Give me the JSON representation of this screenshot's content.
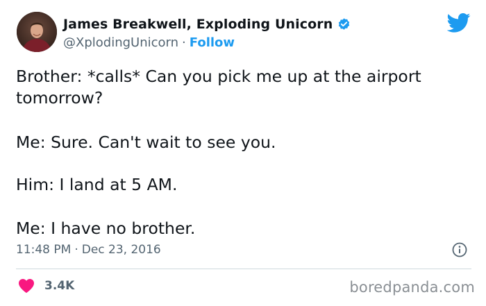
{
  "author": {
    "display_name": "James Breakwell, Exploding Unicorn",
    "handle": "@XplodingUnicorn",
    "separator": "·",
    "follow_label": "Follow",
    "verified": true
  },
  "icons": {
    "verified": "verified-badge-icon",
    "platform": "twitter-bird-icon",
    "info": "info-icon",
    "like": "heart-icon"
  },
  "tweet": {
    "lines": [
      "Brother: *calls* Can you pick me up at the airport",
      "tomorrow?",
      "Me: Sure. Can't wait to see you.",
      "Him: I land at 5 AM.",
      "Me: I have no brother."
    ],
    "time": "11:48 PM",
    "separator": "·",
    "date": "Dec 23, 2016"
  },
  "engagement": {
    "likes": "3.4K"
  },
  "watermark": "boredpanda.com",
  "colors": {
    "accent": "#1d9bf0",
    "text": "#0f1419",
    "muted": "#536471",
    "heart": "#f91880",
    "divider": "#cfd9de"
  }
}
